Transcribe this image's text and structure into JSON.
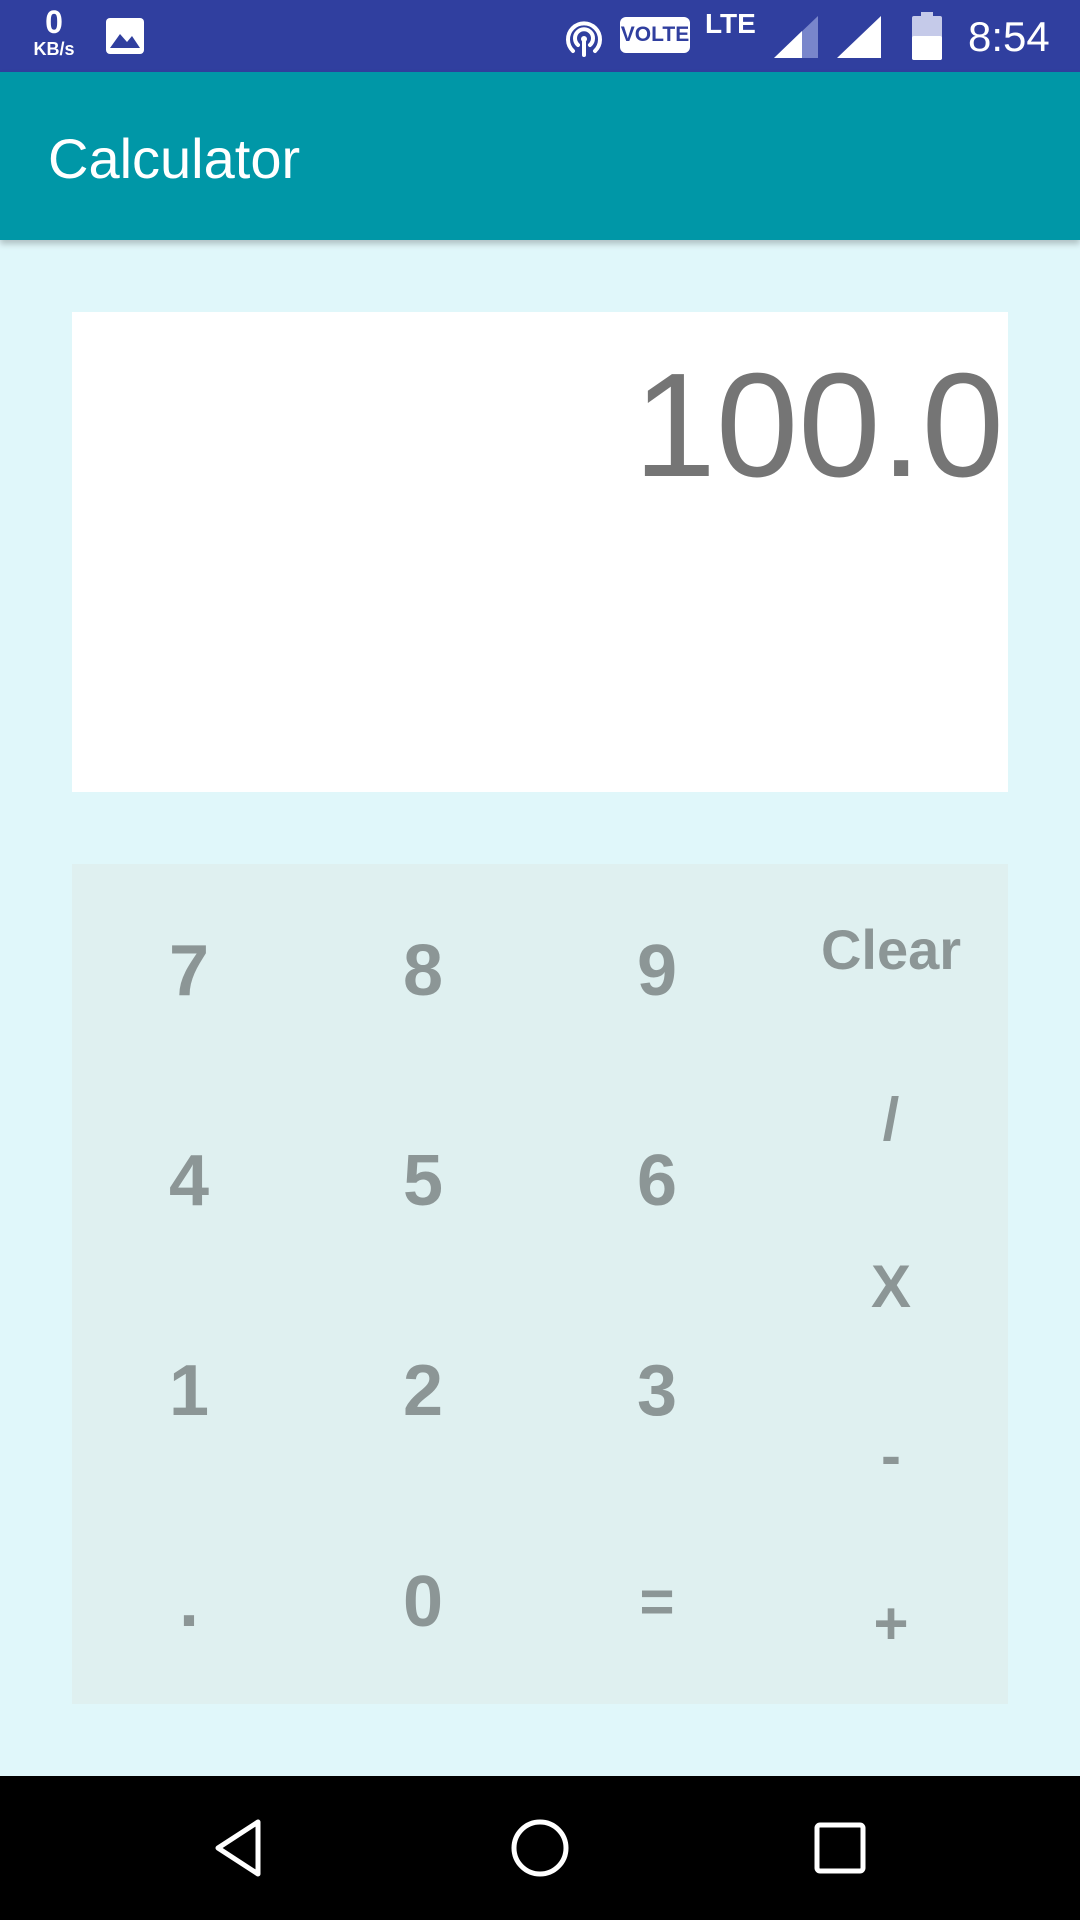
{
  "status_bar": {
    "speed_value": "0",
    "speed_unit": "KB/s",
    "volte_label": "VOLTE",
    "network_label": "LTE",
    "time": "8:54",
    "icons": [
      "gallery-icon",
      "hotspot-icon",
      "signal-icon",
      "signal-icon",
      "battery-icon"
    ]
  },
  "app_bar": {
    "title": "Calculator",
    "color": "#0097a7"
  },
  "display": {
    "value": "100.0"
  },
  "keypad": {
    "digits": {
      "seven": "7",
      "eight": "8",
      "nine": "9",
      "four": "4",
      "five": "5",
      "six": "6",
      "one": "1",
      "two": "2",
      "three": "3",
      "zero": "0"
    },
    "dot": ".",
    "equals": "=",
    "operators": {
      "clear": "Clear",
      "divide": "/",
      "multiply": "X",
      "subtract": "-",
      "add": "+"
    }
  },
  "nav_bar": {
    "icons": [
      "back-icon",
      "home-icon",
      "recents-icon"
    ]
  },
  "colors": {
    "status_bar": "#303f9f",
    "background": "#e0f7fa",
    "keypad": "#dff0f0",
    "key_text": "#8c9696",
    "display_text": "#757575"
  }
}
